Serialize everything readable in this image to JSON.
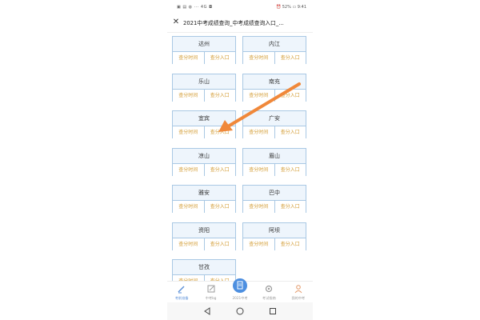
{
  "status_bar": {
    "left": "▣ ▤ ◍ ··· 4G ◘",
    "right": "⏰ 52% ▭ 9:41"
  },
  "header": {
    "title": "2021中考成绩查询_中考成绩查询入口_..."
  },
  "icons": {
    "close": "close-icon"
  },
  "link_labels": {
    "time": "查分时间",
    "entry": "查分入口"
  },
  "cities": [
    {
      "name": "达州"
    },
    {
      "name": "内江"
    },
    {
      "name": "乐山"
    },
    {
      "name": "南充"
    },
    {
      "name": "宜宾"
    },
    {
      "name": "广安"
    },
    {
      "name": "凉山"
    },
    {
      "name": "眉山"
    },
    {
      "name": "雅安"
    },
    {
      "name": "巴中"
    },
    {
      "name": "资阳"
    },
    {
      "name": "阿坝"
    },
    {
      "name": "甘孜"
    }
  ],
  "bottom_nav": [
    {
      "label": "考前准备",
      "icon": "pencil-icon",
      "active": true
    },
    {
      "label": "中考bg",
      "icon": "edit-icon",
      "active": false
    },
    {
      "label": "2021中考",
      "icon": "document-icon",
      "active": false
    },
    {
      "label": "考试指南",
      "icon": "gear-icon",
      "active": false
    },
    {
      "label": "我的中考",
      "icon": "person-icon",
      "active": false
    }
  ],
  "colors": {
    "card_border": "#a9c8e4",
    "card_header_bg": "#eef5fc",
    "link_text": "#d39c33",
    "arrow": "#f0883a",
    "nav_active": "#5a8fd8"
  }
}
